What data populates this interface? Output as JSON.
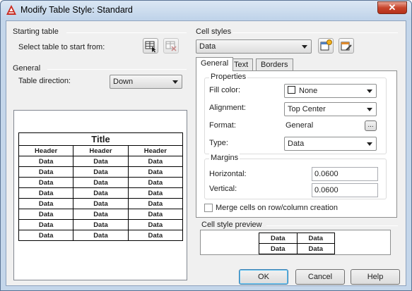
{
  "window": {
    "title": "Modify Table Style: Standard",
    "close_glyph": "✕"
  },
  "starting_table": {
    "title": "Starting table",
    "select_label": "Select table to start from:"
  },
  "general": {
    "title": "General",
    "direction_label": "Table direction:",
    "direction_value": "Down"
  },
  "table_preview": {
    "title": "Title",
    "headers": [
      "Header",
      "Header",
      "Header"
    ],
    "rows": [
      [
        "Data",
        "Data",
        "Data"
      ],
      [
        "Data",
        "Data",
        "Data"
      ],
      [
        "Data",
        "Data",
        "Data"
      ],
      [
        "Data",
        "Data",
        "Data"
      ],
      [
        "Data",
        "Data",
        "Data"
      ],
      [
        "Data",
        "Data",
        "Data"
      ],
      [
        "Data",
        "Data",
        "Data"
      ],
      [
        "Data",
        "Data",
        "Data"
      ]
    ]
  },
  "cell_styles": {
    "title": "Cell styles",
    "selected": "Data"
  },
  "tabs": [
    {
      "label": "General",
      "active": true
    },
    {
      "label": "Text",
      "active": false
    },
    {
      "label": "Borders",
      "active": false
    }
  ],
  "properties": {
    "title": "Properties",
    "fill_color_label": "Fill color:",
    "fill_color_value": "None",
    "alignment_label": "Alignment:",
    "alignment_value": "Top Center",
    "format_label": "Format:",
    "format_value": "General",
    "format_button": "...",
    "type_label": "Type:",
    "type_value": "Data"
  },
  "margins": {
    "title": "Margins",
    "horizontal_label": "Horizontal:",
    "horizontal_value": "0.0600",
    "vertical_label": "Vertical:",
    "vertical_value": "0.0600"
  },
  "merge_label": "Merge cells on row/column creation",
  "cell_style_preview": {
    "title": "Cell style preview",
    "cells": [
      [
        "Data",
        "Data"
      ],
      [
        "Data",
        "Data"
      ]
    ]
  },
  "buttons": {
    "ok": "OK",
    "cancel": "Cancel",
    "help": "Help"
  },
  "colors": {
    "titlebar": "#c4d6ea",
    "dialog_bg": "#f0f0f0",
    "close": "#c7452c",
    "ok_highlight": "#3c7fb1"
  }
}
